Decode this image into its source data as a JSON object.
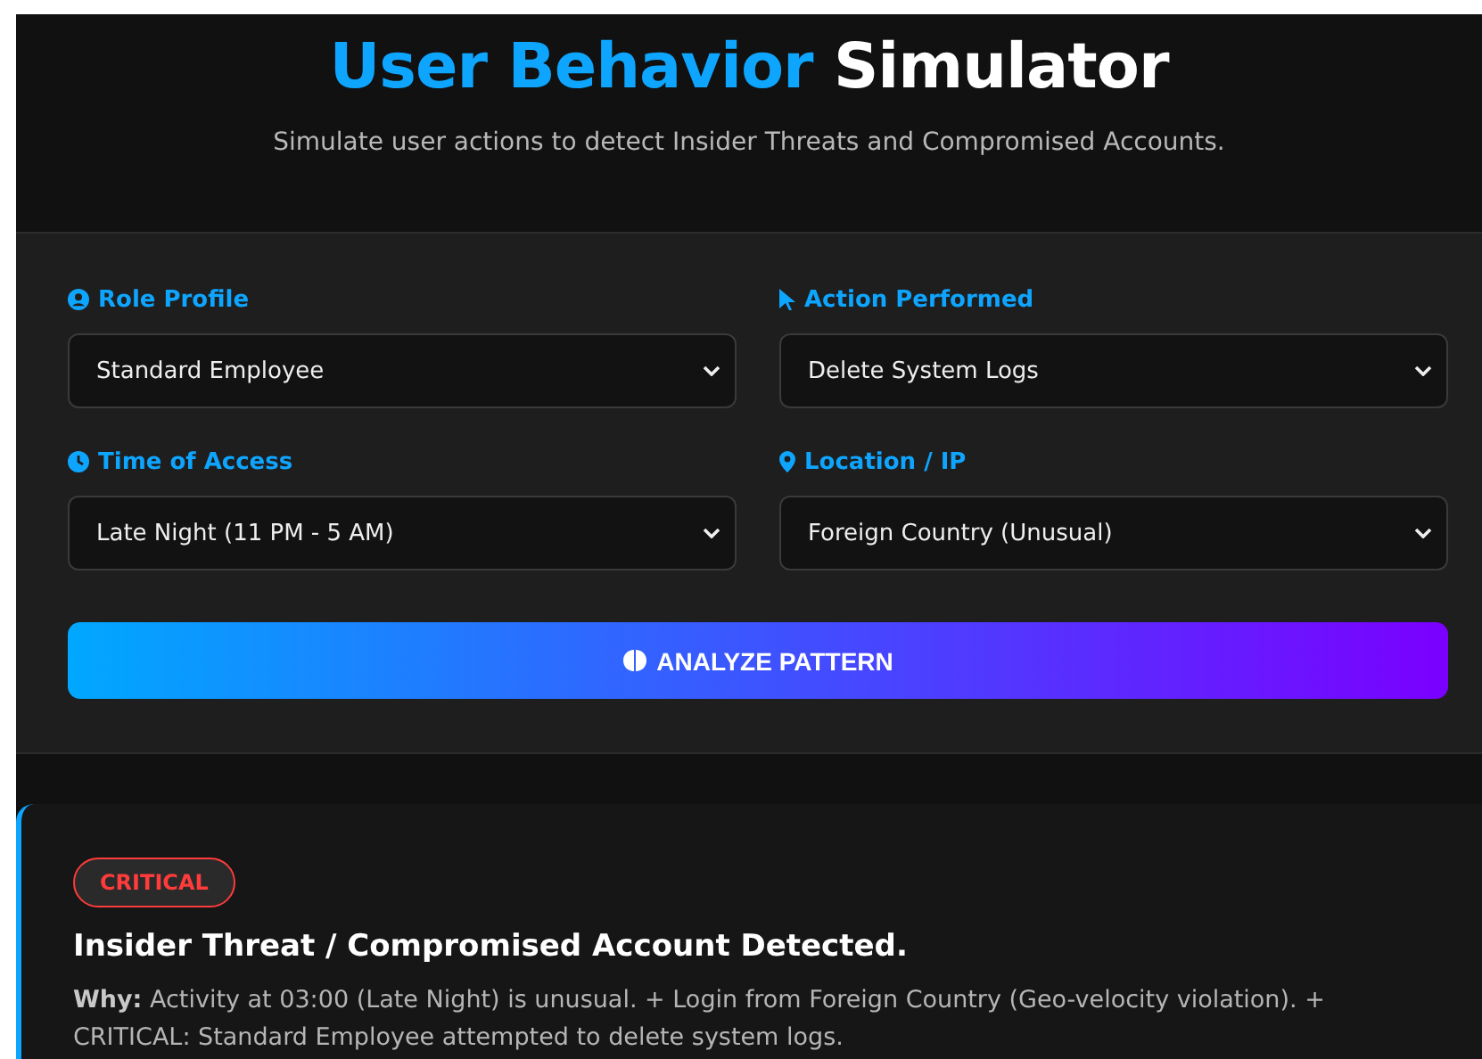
{
  "header": {
    "title_accent": "User Behavior",
    "title_rest": "Simulator",
    "subtitle": "Simulate user actions to detect Insider Threats and Compromised Accounts."
  },
  "fields": [
    {
      "label": "Role Profile",
      "value": "Standard Employee"
    },
    {
      "label": "Action Performed",
      "value": "Delete System Logs"
    },
    {
      "label": "Time of Access",
      "value": "Late Night (11 PM - 5 AM)"
    },
    {
      "label": "Location / IP",
      "value": "Foreign Country (Unusual)"
    }
  ],
  "button": {
    "label": "ANALYZE PATTERN"
  },
  "result": {
    "severity": "CRITICAL",
    "title": "Insider Threat / Compromised Account Detected.",
    "explanation": "**Why:** Activity at 03:00 (Late Night) is unusual. + Login from Foreign Country (Geo-velocity violation). + CRITICAL: Standard Employee attempted to delete system logs."
  }
}
